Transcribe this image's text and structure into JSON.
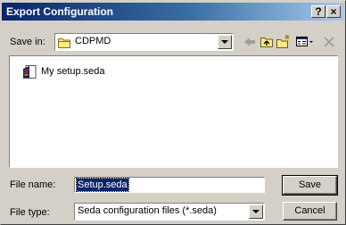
{
  "window": {
    "title": "Export Configuration",
    "help_label": "?",
    "close_label": "×"
  },
  "save_in": {
    "label": "Save in:",
    "value": "CDPMD"
  },
  "file_list": {
    "items": [
      {
        "label": "My setup.seda"
      }
    ]
  },
  "file_name": {
    "label": "File name:",
    "value": "Setup.seda"
  },
  "file_type": {
    "label": "File type:",
    "value": "Seda configuration files (*.seda)"
  },
  "buttons": {
    "save_label": "Save",
    "cancel_label": "Cancel"
  }
}
